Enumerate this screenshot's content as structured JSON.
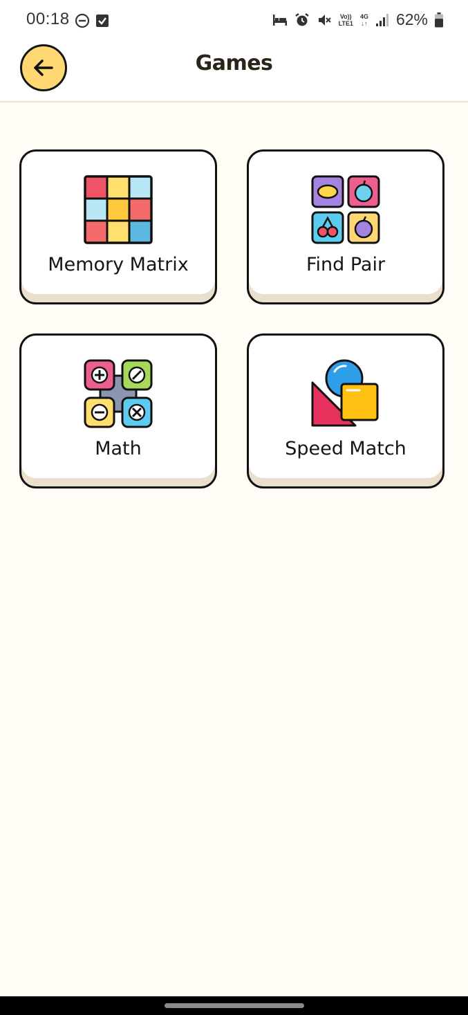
{
  "status_bar": {
    "time": "00:18",
    "battery": "62%",
    "network_top": "Vo))",
    "network_bottom": "LTE1",
    "gen_top": "4G",
    "gen_bottom": "↓↑"
  },
  "header": {
    "title": "Games",
    "back_icon": "arrow-left-icon"
  },
  "games": [
    {
      "label": "Memory Matrix",
      "icon": "memory-matrix-icon"
    },
    {
      "label": "Find Pair",
      "icon": "find-pair-icon"
    },
    {
      "label": "Math",
      "icon": "math-icon"
    },
    {
      "label": "Speed Match",
      "icon": "speed-match-icon"
    }
  ],
  "colors": {
    "background": "#fffdf6",
    "accent": "#ffd873",
    "card_shadow": "#eadfcd"
  }
}
